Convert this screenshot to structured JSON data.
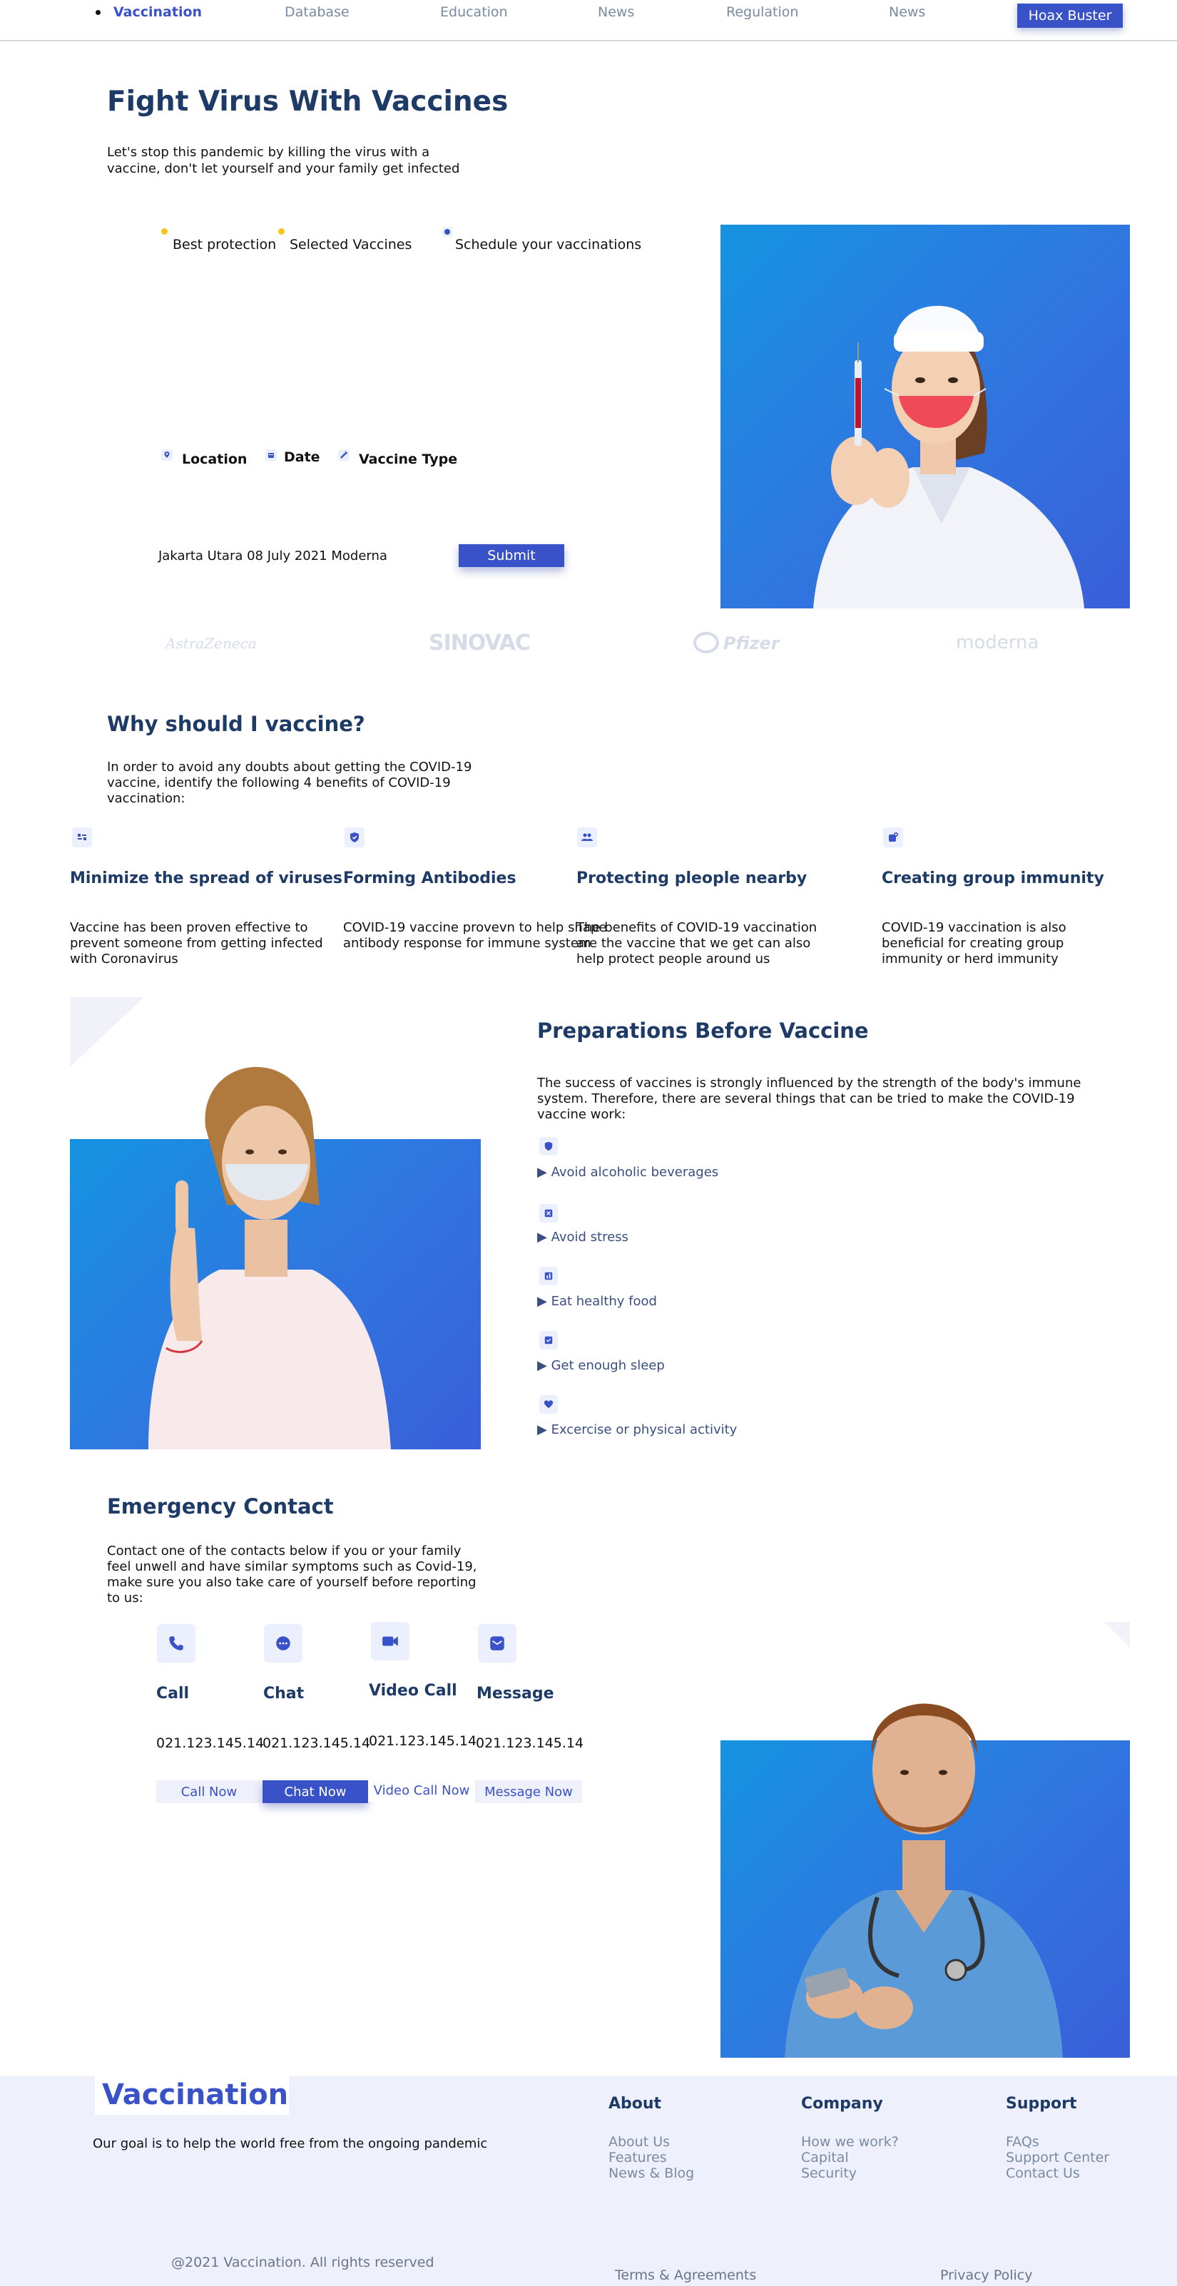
{
  "nav": {
    "brand": "Vaccination",
    "links": [
      "Database",
      "Education",
      "News",
      "Regulation",
      "News"
    ],
    "cta": "Hoax Buster"
  },
  "hero": {
    "title": "Fight Virus With Vaccines",
    "subtitle": "Let's stop this pandemic by killing the virus with a vaccine, don't let yourself and your family get infected",
    "tabs": [
      "Best protection",
      "Selected Vaccines",
      "Schedule your vaccinations"
    ],
    "form_labels": [
      "Location",
      "Date",
      "Vaccine Type"
    ],
    "form_values": "Jakarta Utara 08 July 2021 Moderna",
    "submit": "Submit"
  },
  "brands": [
    "AstraZeneca",
    "SINOVAC",
    "Pfizer",
    "moderna"
  ],
  "why": {
    "title": "Why should I vaccine?",
    "intro": "In order to avoid any doubts about getting the COVID-19 vaccine, identify the following 4 benefits of COVID-19 vaccination:",
    "items": [
      {
        "title": "Minimize the spread of viruses",
        "text": "Vaccine has been proven effective to prevent someone from getting infected with Coronavirus",
        "icon": "list-icon"
      },
      {
        "title": "Forming Antibodies",
        "text": "COVID-19 vaccine provevn to help shape antibody response for immune system",
        "icon": "shield-icon"
      },
      {
        "title": "Protecting pleople nearby",
        "text": "The benefits of COVID-19 vaccination are the vaccine that we get can also help protect people around us",
        "icon": "people-icon"
      },
      {
        "title": "Creating group immunity",
        "text": "COVID-19 vaccination is also beneficial for creating group immunity or herd immunity",
        "icon": "group-icon"
      }
    ]
  },
  "prep": {
    "title": "Preparations Before Vaccine",
    "intro": "The success of vaccines is strongly influenced by the strength of the body's immune system. Therefore, there are several things that can be tried to make the COVID-19 vaccine work:",
    "items": [
      "Avoid alcoholic beverages",
      "Avoid stress",
      "Eat healthy food",
      "Get enough sleep",
      "Excercise or physical activity"
    ]
  },
  "emergency": {
    "title": "Emergency Contact",
    "intro": "Contact one of the contacts below if you or your family feel unwell and have similar symptoms such as Covid-19, make sure you also take care of yourself before reporting to us:",
    "contacts": [
      {
        "title": "Call",
        "number": "021.123.145.14",
        "button": "Call Now",
        "icon": "phone-icon"
      },
      {
        "title": "Chat",
        "number": "021.123.145.14",
        "button": "Chat Now",
        "icon": "chat-icon"
      },
      {
        "title": "Video Call",
        "number": "021.123.145.14",
        "button": "Video Call Now",
        "icon": "video-icon"
      },
      {
        "title": "Message",
        "number": "021.123.145.14",
        "button": "Message Now",
        "icon": "mail-icon"
      }
    ]
  },
  "footer": {
    "brand": "Vaccination",
    "tagline": "Our goal is to help the world free from the ongoing pandemic",
    "columns": [
      {
        "title": "About",
        "links": [
          "About Us",
          "Features",
          "News & Blog"
        ]
      },
      {
        "title": "Company",
        "links": [
          "How we work?",
          "Capital",
          "Security"
        ]
      },
      {
        "title": "Support",
        "links": [
          "FAQs",
          "Support Center",
          "Contact Us"
        ]
      }
    ],
    "copyright": "@2021 Vaccination. All rights reserved",
    "terms": "Terms & Agreements",
    "privacy": "Privacy Policy"
  },
  "colors": {
    "primary": "#3a52c7",
    "navy": "#1e3a66",
    "footer_bg": "#eef0fc",
    "image_blue": "#1593e0"
  }
}
